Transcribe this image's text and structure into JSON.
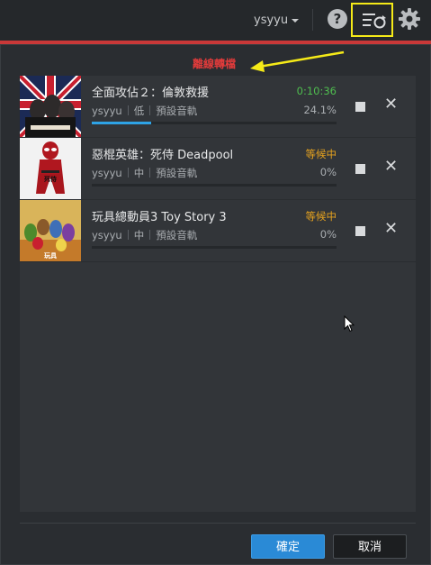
{
  "topbar": {
    "user": "ysyyu",
    "help_glyph": "?"
  },
  "annotation": {
    "text": "離線轉檔"
  },
  "queue": [
    {
      "title": "全面攻佔２：倫敦救援",
      "user": "ysyyu",
      "priority": "低",
      "profile": "預設音軌",
      "status": "0:10:36",
      "status_color": "#4fbd4f",
      "percent": "24.1%",
      "progress": 0.241
    },
    {
      "title": "惡棍英雄：死侍 Deadpool",
      "user": "ysyyu",
      "priority": "中",
      "profile": "預設音軌",
      "status": "等候中",
      "status_color": "#e5a21f",
      "percent": "0%",
      "progress": 0
    },
    {
      "title": "玩具總動員3 Toy Story 3",
      "user": "ysyyu",
      "priority": "中",
      "profile": "預設音軌",
      "status": "等候中",
      "status_color": "#e5a21f",
      "percent": "0%",
      "progress": 0
    }
  ],
  "buttons": {
    "ok": "確定",
    "cancel": "取消"
  },
  "colors": {
    "accent": "#2a8ad6",
    "highlight_box": "#f5ea18",
    "annotation": "#e23b3b"
  }
}
